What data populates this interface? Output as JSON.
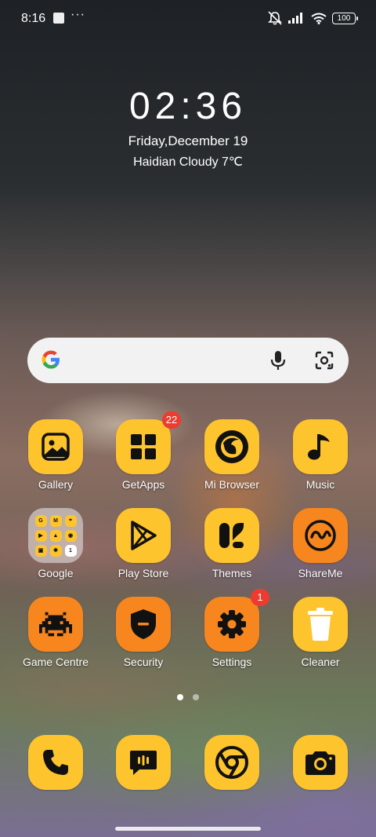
{
  "status_bar": {
    "time": "8:16",
    "more": "···",
    "battery": "100"
  },
  "clock_widget": {
    "time": "02:36",
    "date": "Friday,December 19",
    "weather": "Haidian Cloudy 7℃"
  },
  "search": {
    "icons": [
      "google-logo",
      "mic-icon",
      "lens-icon"
    ]
  },
  "apps": {
    "row1": [
      {
        "label": "Gallery",
        "icon": "gallery-icon"
      },
      {
        "label": "GetApps",
        "icon": "getapps-icon",
        "badge": "22"
      },
      {
        "label": "Mi Browser",
        "icon": "browser-icon"
      },
      {
        "label": "Music",
        "icon": "music-note-icon"
      }
    ],
    "row2": [
      {
        "label": "Google",
        "icon": "folder-icon"
      },
      {
        "label": "Play Store",
        "icon": "play-store-icon"
      },
      {
        "label": "Themes",
        "icon": "themes-icon"
      },
      {
        "label": "ShareMe",
        "icon": "shareme-icon"
      }
    ],
    "row3": [
      {
        "label": "Game Centre",
        "icon": "game-invader-icon"
      },
      {
        "label": "Security",
        "icon": "shield-icon"
      },
      {
        "label": "Settings",
        "icon": "gear-icon",
        "badge": "1"
      },
      {
        "label": "Cleaner",
        "icon": "trash-icon"
      }
    ]
  },
  "folder_google": {
    "minis": [
      "G",
      "M",
      "⌖",
      "▶",
      "▲",
      "◉",
      "▣",
      "✱",
      "1"
    ]
  },
  "dock": {
    "icons": [
      "phone-icon",
      "messages-icon",
      "chrome-icon",
      "camera-icon"
    ]
  },
  "pages": {
    "count": 2,
    "active": 1
  },
  "colors": {
    "accent": "#fec42e",
    "accent_orange": "#f7861f",
    "badge": "#ee3b2f"
  }
}
